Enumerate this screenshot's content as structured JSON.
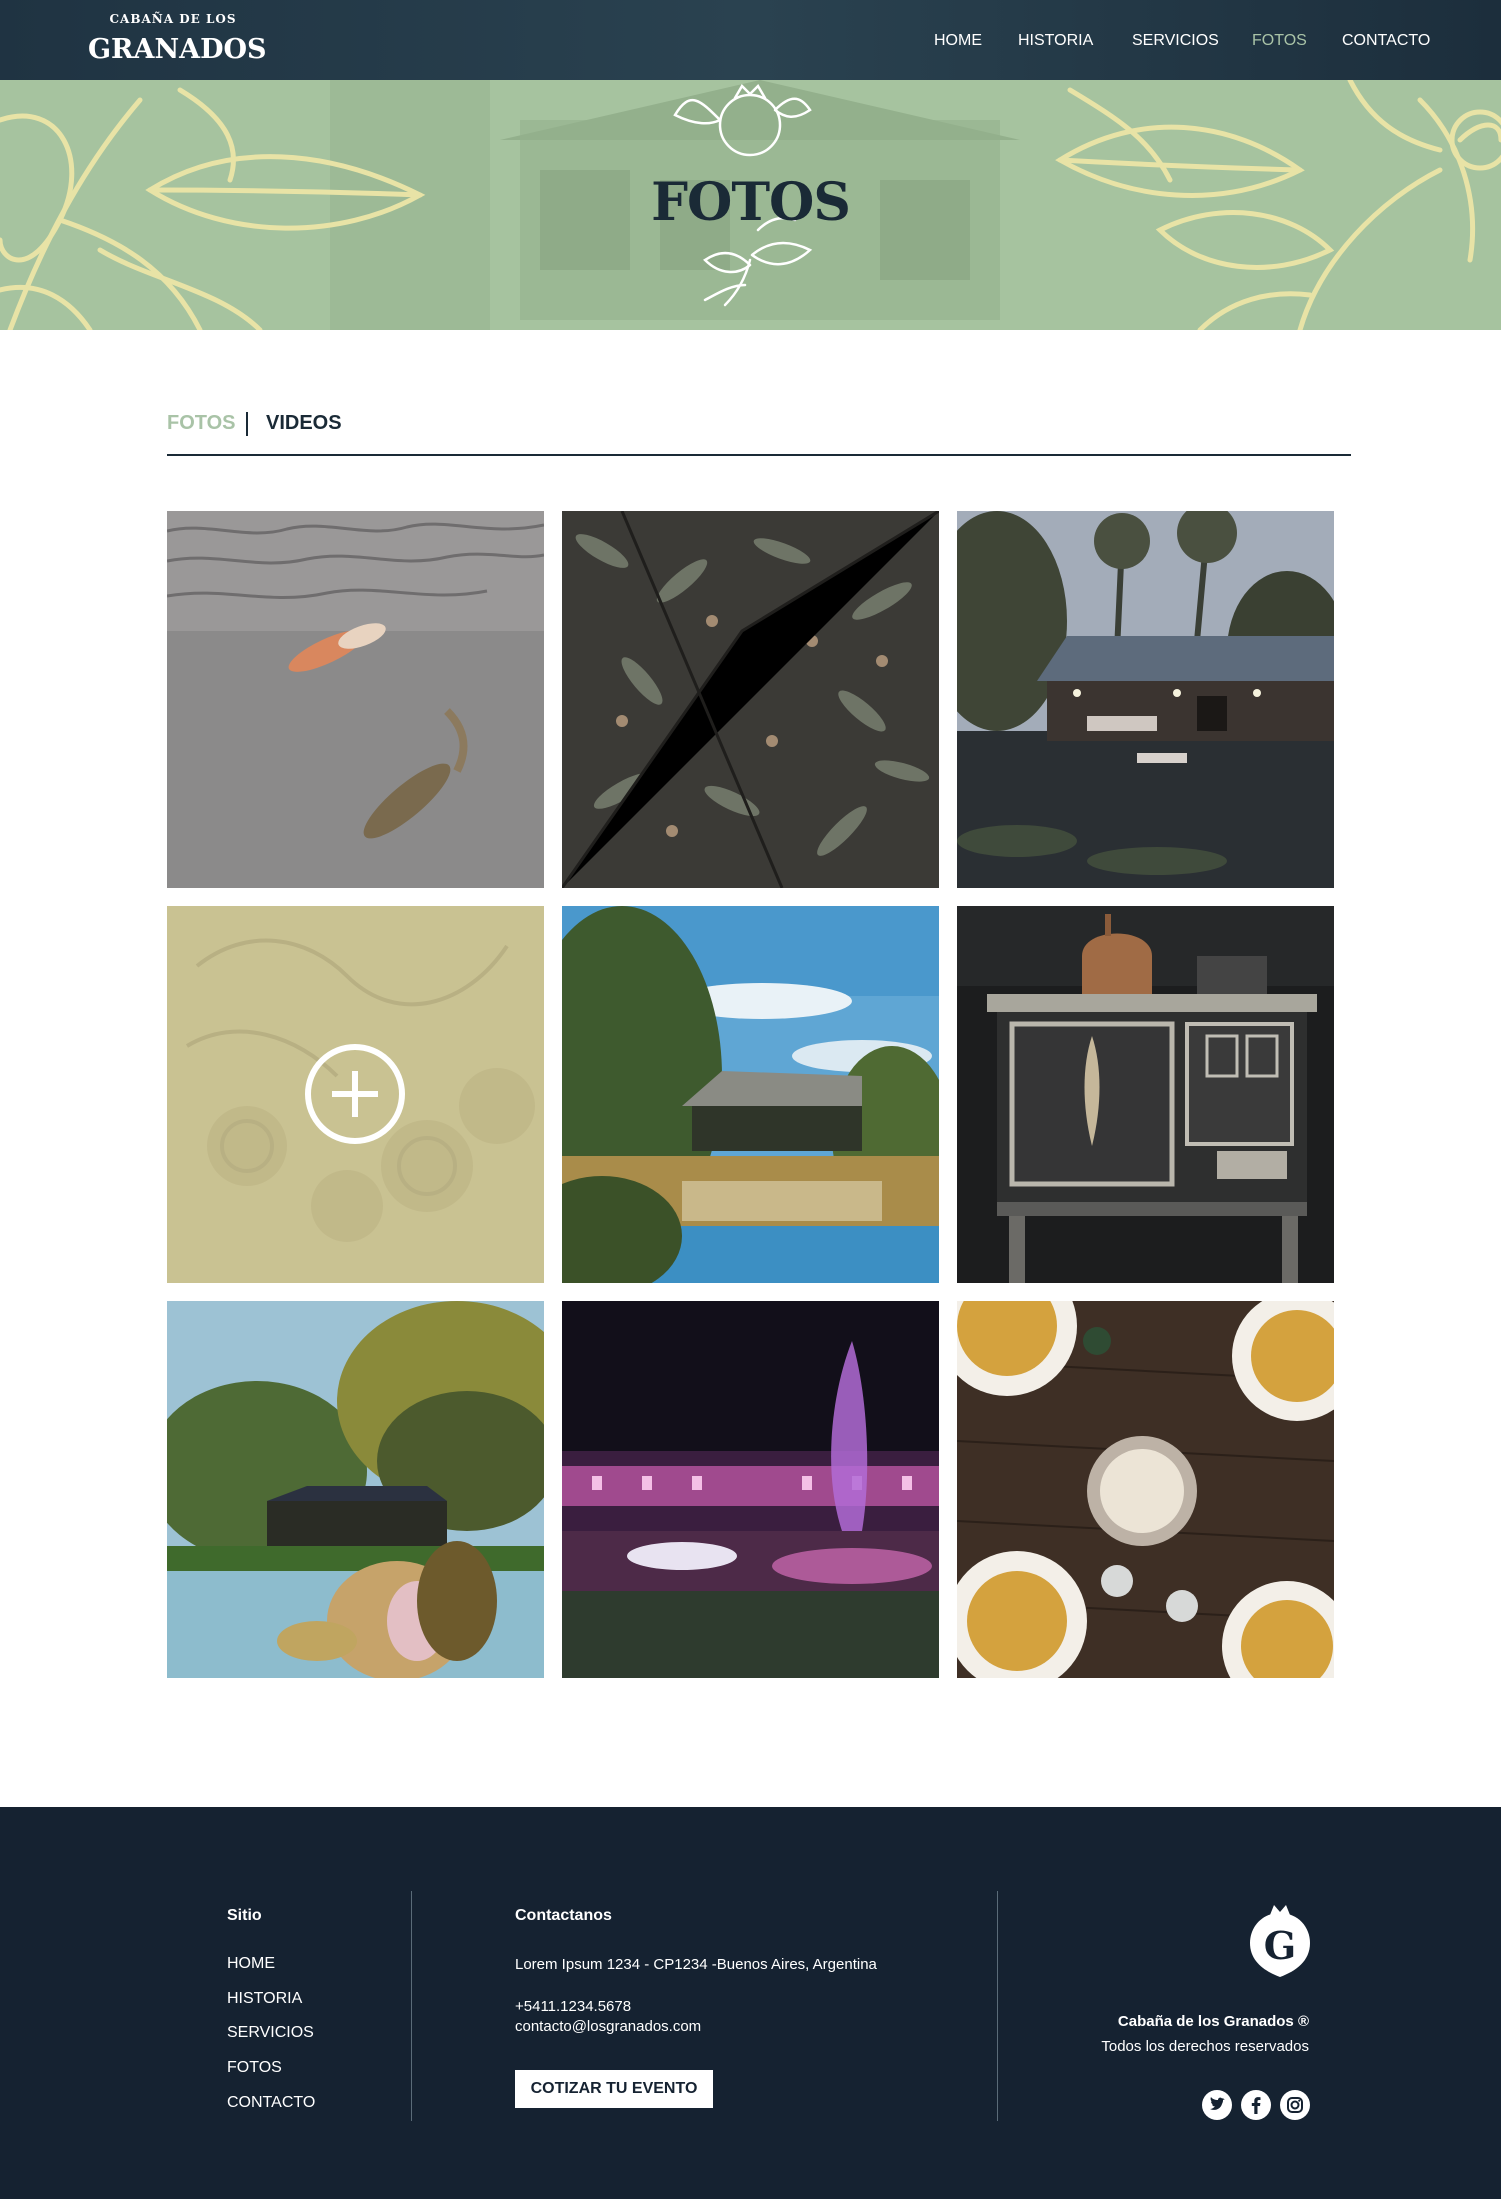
{
  "brand": {
    "small": "CABAÑA DE LOS",
    "big": "GRANADOS"
  },
  "nav": {
    "items": [
      "HOME",
      "HISTORIA",
      "SERVICIOS",
      "FOTOS",
      "CONTACTO"
    ],
    "active": "FOTOS"
  },
  "hero": {
    "title": "FOTOS"
  },
  "tabs": {
    "fotos": "FOTOS",
    "videos": "VIDEOS",
    "active": "FOTOS"
  },
  "gallery": {
    "photos": [
      "koi-pond",
      "olive-tree",
      "cabin-lake-night",
      "seashells-more",
      "cabin-pond-day",
      "antique-stove",
      "garden-flowers",
      "fountain-night",
      "risotto-table"
    ]
  },
  "footer": {
    "sitio": {
      "heading": "Sitio",
      "links": [
        "HOME",
        "HISTORIA",
        "SERVICIOS",
        "FOTOS",
        "CONTACTO"
      ]
    },
    "contact": {
      "heading": "Contactanos",
      "address": "Lorem Ipsum 1234 - CP1234 -Buenos Aires, Argentina",
      "phone": "+5411.1234.5678",
      "email": "contacto@losgranados.com",
      "cta": "COTIZAR TU EVENTO"
    },
    "brand": {
      "name": "Cabaña de los Granados ®",
      "rights": "Todos los derechos reservados"
    },
    "social": [
      "twitter-icon",
      "facebook-icon",
      "instagram-icon"
    ]
  },
  "colors": {
    "navy": "#152231",
    "sage": "#a6c39f",
    "accent": "#a9c3a7",
    "cream": "#e2dea8"
  }
}
